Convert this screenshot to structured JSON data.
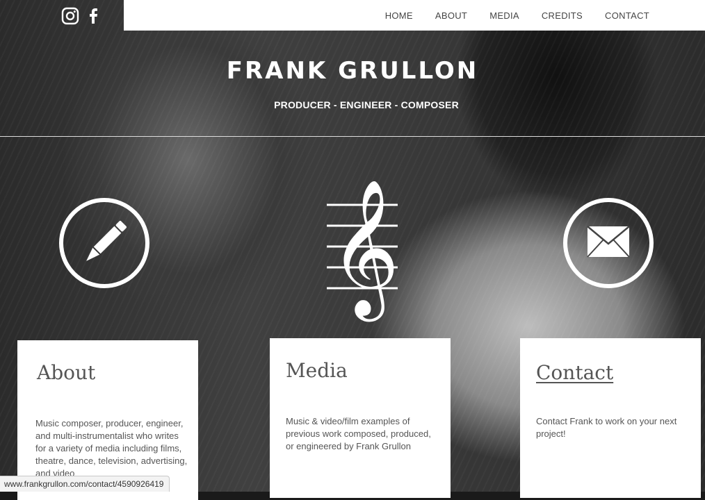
{
  "header": {
    "social_icons": [
      "instagram-icon",
      "facebook-icon"
    ],
    "nav": [
      "HOME",
      "ABOUT",
      "MEDIA",
      "CREDITS",
      "CONTACT"
    ]
  },
  "hero": {
    "title": "FRANK GRULLON",
    "subtitle": "PRODUCER - ENGINEER - COMPOSER",
    "icons": [
      "pencil-icon",
      "treble-clef-icon",
      "envelope-icon"
    ]
  },
  "cards": [
    {
      "title": "About",
      "text": "Music composer, producer, engineer, and multi-instrumentalist who writes for a variety of media including films, theatre, dance, television, advertising, and video"
    },
    {
      "title": "Media",
      "text": "Music & video/film examples of previous work composed, produced, or engineered by Frank Grullon"
    },
    {
      "title": "Contact",
      "text": "Contact Frank to work on your next project!"
    }
  ],
  "status_bar": {
    "url": "www.frankgrullon.com/contact/4590926419"
  },
  "colors": {
    "topbar": "#ffffff",
    "text_dark": "#555555",
    "accent": "#ffffff"
  }
}
